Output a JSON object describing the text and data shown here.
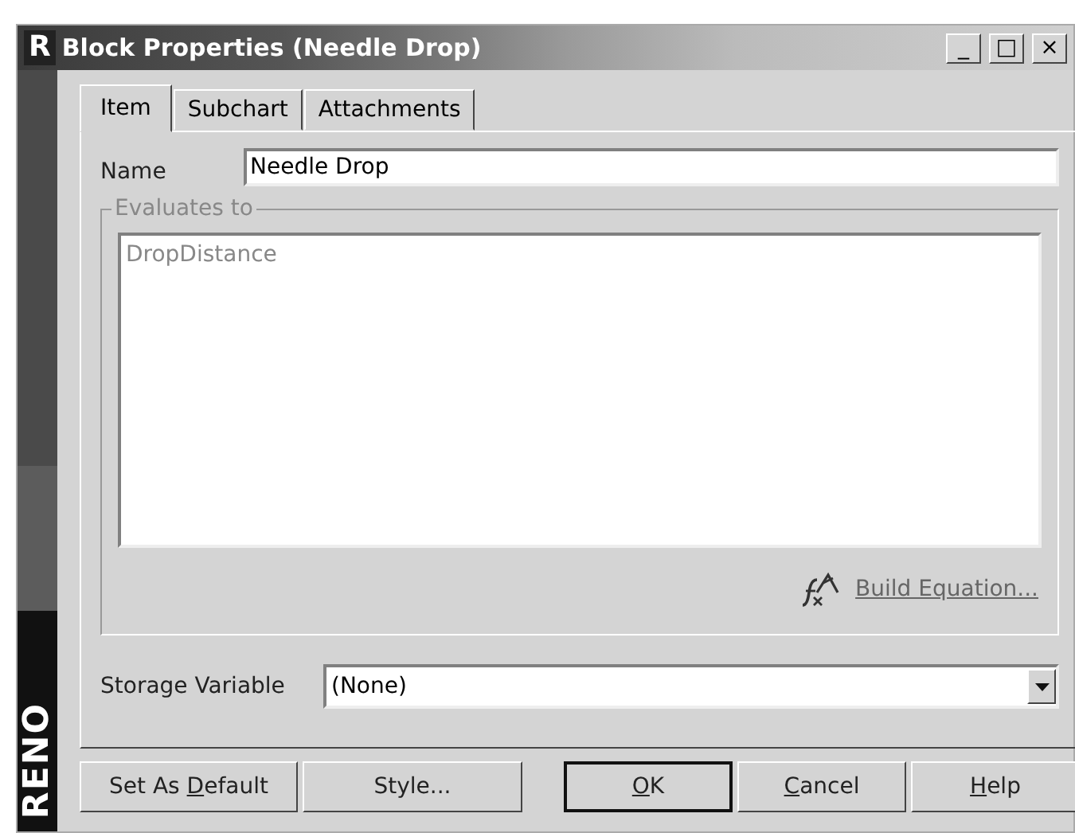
{
  "window": {
    "logo": "R",
    "title": "Block Properties (Needle Drop)",
    "controls": [
      "_",
      "□",
      "×"
    ]
  },
  "side_strip": {
    "brand": "RENO"
  },
  "tabs": [
    {
      "label": "Item",
      "selected": true
    },
    {
      "label": "Subchart",
      "selected": false
    },
    {
      "label": "Attachments",
      "selected": false
    }
  ],
  "name_field": {
    "label": "Name",
    "value": "Needle Drop"
  },
  "evaluates_to": {
    "label": "Evaluates to",
    "value": "DropDistance",
    "disabled": true
  },
  "build_equation_link": "Build Equation...",
  "storage_variable": {
    "label": "Storage Variable",
    "value": "(None)"
  },
  "buttons": [
    {
      "before": "Set As ",
      "key": "D",
      "after": "efault",
      "default": false
    },
    {
      "before": "Style...",
      "default": false
    },
    {
      "key": "O",
      "after": "K",
      "default": true
    },
    {
      "key": "C",
      "after": "ancel",
      "default": false
    },
    {
      "key": "H",
      "after": "elp",
      "default": false
    }
  ]
}
